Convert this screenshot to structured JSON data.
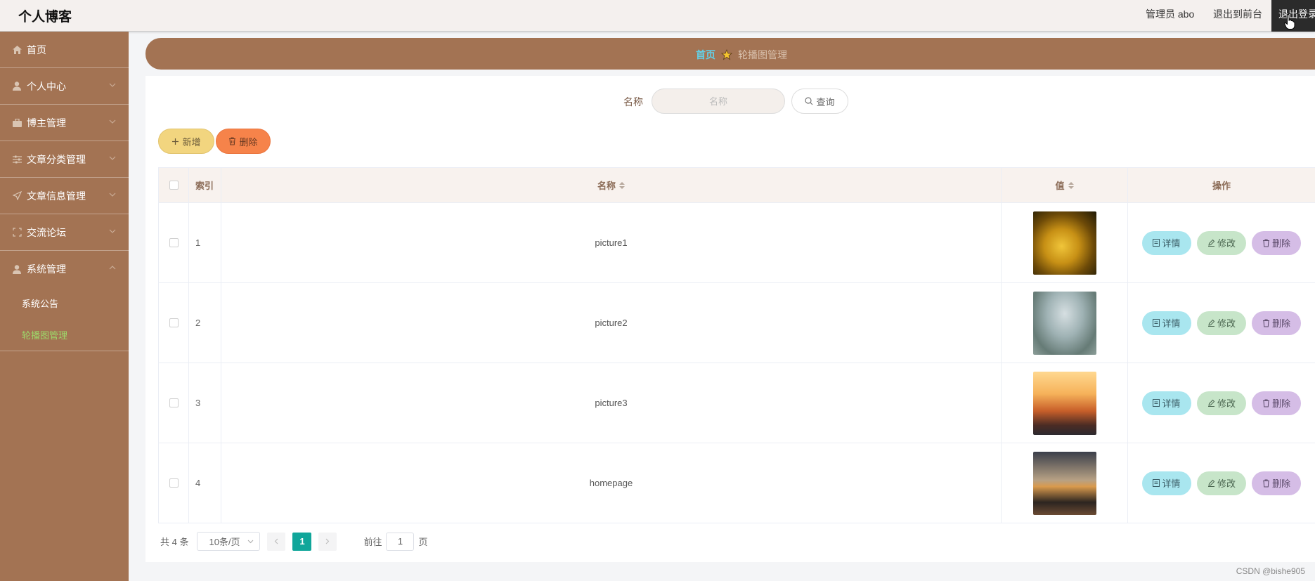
{
  "topbar": {
    "brand": "个人博客",
    "admin_label": "管理员 abo",
    "front_label": "退出到前台",
    "logout_label": "退出登录"
  },
  "sidebar": {
    "items": [
      {
        "label": "首页",
        "icon": "home-icon"
      },
      {
        "label": "个人中心",
        "icon": "user-icon"
      },
      {
        "label": "博主管理",
        "icon": "briefcase-icon"
      },
      {
        "label": "文章分类管理",
        "icon": "sliders-icon"
      },
      {
        "label": "文章信息管理",
        "icon": "send-icon"
      },
      {
        "label": "交流论坛",
        "icon": "fullscreen-icon"
      },
      {
        "label": "系统管理",
        "icon": "user-icon"
      }
    ],
    "sub_items": [
      {
        "label": "系统公告"
      },
      {
        "label": "轮播图管理"
      }
    ]
  },
  "breadcrumb": {
    "home": "首页",
    "current": "轮播图管理"
  },
  "search": {
    "label": "名称",
    "placeholder": "名称",
    "query_label": "查询"
  },
  "actions": {
    "add_label": "新增",
    "delete_label": "删除"
  },
  "table": {
    "headers": {
      "index": "索引",
      "name": "名称",
      "value": "值",
      "ops": "操作"
    },
    "rows": [
      {
        "index": "1",
        "name": "picture1"
      },
      {
        "index": "2",
        "name": "picture2"
      },
      {
        "index": "3",
        "name": "picture3"
      },
      {
        "index": "4",
        "name": "homepage"
      }
    ],
    "op_labels": {
      "detail": "详情",
      "edit": "修改",
      "delete": "删除"
    }
  },
  "pagination": {
    "total": "共 4 条",
    "page_size": "10条/页",
    "current_page": "1",
    "goto_prefix": "前往",
    "goto_value": "1",
    "goto_suffix": "页"
  },
  "watermark": "CSDN @bishe905",
  "colors": {
    "primary": "#a37353",
    "accent_link": "#63d0e6",
    "active_page": "#10a69a",
    "add_button": "#f2d57f",
    "delete_button": "#f6834a"
  }
}
